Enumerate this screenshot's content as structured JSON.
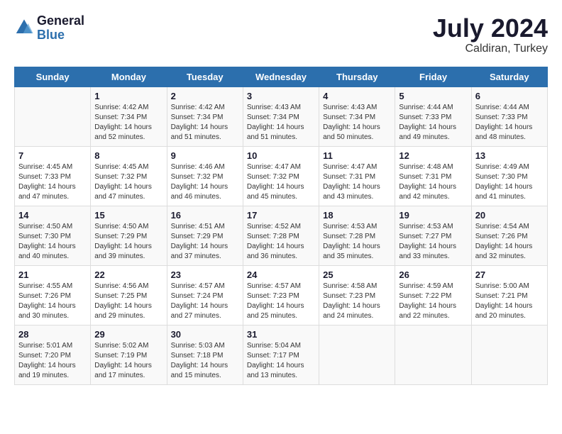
{
  "header": {
    "logo_line1": "General",
    "logo_line2": "Blue",
    "month": "July 2024",
    "location": "Caldiran, Turkey"
  },
  "weekdays": [
    "Sunday",
    "Monday",
    "Tuesday",
    "Wednesday",
    "Thursday",
    "Friday",
    "Saturday"
  ],
  "weeks": [
    [
      {
        "day": "",
        "sunrise": "",
        "sunset": "",
        "daylight": ""
      },
      {
        "day": "1",
        "sunrise": "Sunrise: 4:42 AM",
        "sunset": "Sunset: 7:34 PM",
        "daylight": "Daylight: 14 hours and 52 minutes."
      },
      {
        "day": "2",
        "sunrise": "Sunrise: 4:42 AM",
        "sunset": "Sunset: 7:34 PM",
        "daylight": "Daylight: 14 hours and 51 minutes."
      },
      {
        "day": "3",
        "sunrise": "Sunrise: 4:43 AM",
        "sunset": "Sunset: 7:34 PM",
        "daylight": "Daylight: 14 hours and 51 minutes."
      },
      {
        "day": "4",
        "sunrise": "Sunrise: 4:43 AM",
        "sunset": "Sunset: 7:34 PM",
        "daylight": "Daylight: 14 hours and 50 minutes."
      },
      {
        "day": "5",
        "sunrise": "Sunrise: 4:44 AM",
        "sunset": "Sunset: 7:33 PM",
        "daylight": "Daylight: 14 hours and 49 minutes."
      },
      {
        "day": "6",
        "sunrise": "Sunrise: 4:44 AM",
        "sunset": "Sunset: 7:33 PM",
        "daylight": "Daylight: 14 hours and 48 minutes."
      }
    ],
    [
      {
        "day": "7",
        "sunrise": "Sunrise: 4:45 AM",
        "sunset": "Sunset: 7:33 PM",
        "daylight": "Daylight: 14 hours and 47 minutes."
      },
      {
        "day": "8",
        "sunrise": "Sunrise: 4:45 AM",
        "sunset": "Sunset: 7:32 PM",
        "daylight": "Daylight: 14 hours and 47 minutes."
      },
      {
        "day": "9",
        "sunrise": "Sunrise: 4:46 AM",
        "sunset": "Sunset: 7:32 PM",
        "daylight": "Daylight: 14 hours and 46 minutes."
      },
      {
        "day": "10",
        "sunrise": "Sunrise: 4:47 AM",
        "sunset": "Sunset: 7:32 PM",
        "daylight": "Daylight: 14 hours and 45 minutes."
      },
      {
        "day": "11",
        "sunrise": "Sunrise: 4:47 AM",
        "sunset": "Sunset: 7:31 PM",
        "daylight": "Daylight: 14 hours and 43 minutes."
      },
      {
        "day": "12",
        "sunrise": "Sunrise: 4:48 AM",
        "sunset": "Sunset: 7:31 PM",
        "daylight": "Daylight: 14 hours and 42 minutes."
      },
      {
        "day": "13",
        "sunrise": "Sunrise: 4:49 AM",
        "sunset": "Sunset: 7:30 PM",
        "daylight": "Daylight: 14 hours and 41 minutes."
      }
    ],
    [
      {
        "day": "14",
        "sunrise": "Sunrise: 4:50 AM",
        "sunset": "Sunset: 7:30 PM",
        "daylight": "Daylight: 14 hours and 40 minutes."
      },
      {
        "day": "15",
        "sunrise": "Sunrise: 4:50 AM",
        "sunset": "Sunset: 7:29 PM",
        "daylight": "Daylight: 14 hours and 39 minutes."
      },
      {
        "day": "16",
        "sunrise": "Sunrise: 4:51 AM",
        "sunset": "Sunset: 7:29 PM",
        "daylight": "Daylight: 14 hours and 37 minutes."
      },
      {
        "day": "17",
        "sunrise": "Sunrise: 4:52 AM",
        "sunset": "Sunset: 7:28 PM",
        "daylight": "Daylight: 14 hours and 36 minutes."
      },
      {
        "day": "18",
        "sunrise": "Sunrise: 4:53 AM",
        "sunset": "Sunset: 7:28 PM",
        "daylight": "Daylight: 14 hours and 35 minutes."
      },
      {
        "day": "19",
        "sunrise": "Sunrise: 4:53 AM",
        "sunset": "Sunset: 7:27 PM",
        "daylight": "Daylight: 14 hours and 33 minutes."
      },
      {
        "day": "20",
        "sunrise": "Sunrise: 4:54 AM",
        "sunset": "Sunset: 7:26 PM",
        "daylight": "Daylight: 14 hours and 32 minutes."
      }
    ],
    [
      {
        "day": "21",
        "sunrise": "Sunrise: 4:55 AM",
        "sunset": "Sunset: 7:26 PM",
        "daylight": "Daylight: 14 hours and 30 minutes."
      },
      {
        "day": "22",
        "sunrise": "Sunrise: 4:56 AM",
        "sunset": "Sunset: 7:25 PM",
        "daylight": "Daylight: 14 hours and 29 minutes."
      },
      {
        "day": "23",
        "sunrise": "Sunrise: 4:57 AM",
        "sunset": "Sunset: 7:24 PM",
        "daylight": "Daylight: 14 hours and 27 minutes."
      },
      {
        "day": "24",
        "sunrise": "Sunrise: 4:57 AM",
        "sunset": "Sunset: 7:23 PM",
        "daylight": "Daylight: 14 hours and 25 minutes."
      },
      {
        "day": "25",
        "sunrise": "Sunrise: 4:58 AM",
        "sunset": "Sunset: 7:23 PM",
        "daylight": "Daylight: 14 hours and 24 minutes."
      },
      {
        "day": "26",
        "sunrise": "Sunrise: 4:59 AM",
        "sunset": "Sunset: 7:22 PM",
        "daylight": "Daylight: 14 hours and 22 minutes."
      },
      {
        "day": "27",
        "sunrise": "Sunrise: 5:00 AM",
        "sunset": "Sunset: 7:21 PM",
        "daylight": "Daylight: 14 hours and 20 minutes."
      }
    ],
    [
      {
        "day": "28",
        "sunrise": "Sunrise: 5:01 AM",
        "sunset": "Sunset: 7:20 PM",
        "daylight": "Daylight: 14 hours and 19 minutes."
      },
      {
        "day": "29",
        "sunrise": "Sunrise: 5:02 AM",
        "sunset": "Sunset: 7:19 PM",
        "daylight": "Daylight: 14 hours and 17 minutes."
      },
      {
        "day": "30",
        "sunrise": "Sunrise: 5:03 AM",
        "sunset": "Sunset: 7:18 PM",
        "daylight": "Daylight: 14 hours and 15 minutes."
      },
      {
        "day": "31",
        "sunrise": "Sunrise: 5:04 AM",
        "sunset": "Sunset: 7:17 PM",
        "daylight": "Daylight: 14 hours and 13 minutes."
      },
      {
        "day": "",
        "sunrise": "",
        "sunset": "",
        "daylight": ""
      },
      {
        "day": "",
        "sunrise": "",
        "sunset": "",
        "daylight": ""
      },
      {
        "day": "",
        "sunrise": "",
        "sunset": "",
        "daylight": ""
      }
    ]
  ]
}
